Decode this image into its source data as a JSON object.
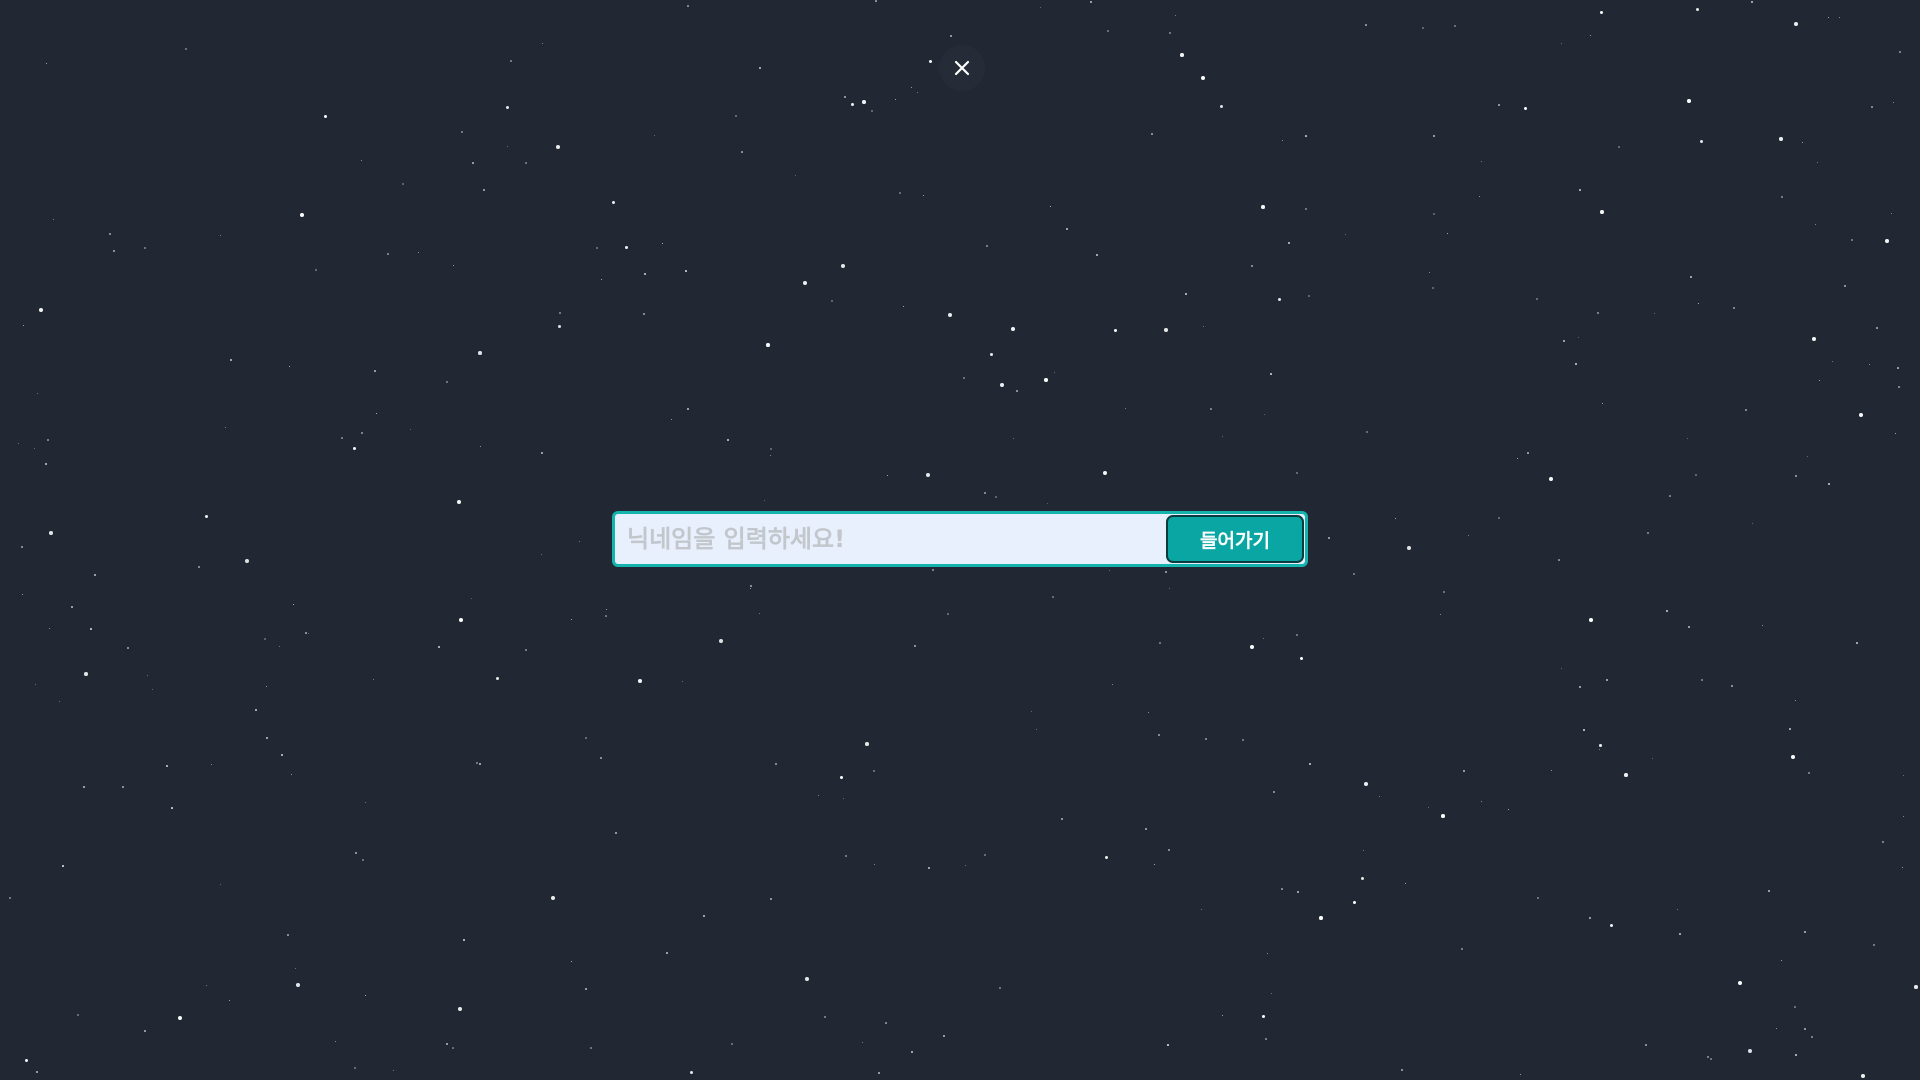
{
  "close_button": {
    "icon": "close-icon",
    "icon_color": "#ffffff"
  },
  "nickname_form": {
    "placeholder": "닉네임을 입력하세요!",
    "value": "",
    "submit_label": "들어가기"
  },
  "colors": {
    "background": "#222833",
    "accent": "#0aa6a3",
    "input_background": "#e8f0fe",
    "star": "#ffffff"
  }
}
